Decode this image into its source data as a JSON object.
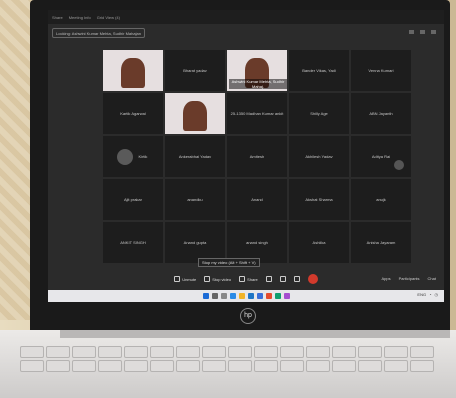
{
  "meeting_tabs": [
    "Share",
    "Meeting Info",
    "Grid View (4)"
  ],
  "locked_label": "Locking: Ashwini Kumar Mehta, Sudhir Mahajan",
  "participants": [
    {
      "name": "",
      "video": true
    },
    {
      "name": "Bharat yadav",
      "video": false
    },
    {
      "name": "Ashwini Kumar Mehta, Sudhir Mahaj.",
      "video": true
    },
    {
      "name": "Bander Vikas, Yadi",
      "video": false
    },
    {
      "name": "Venna Kumari",
      "video": false
    },
    {
      "name": "Kartik Agarwal",
      "video": false
    },
    {
      "name": "",
      "video": true
    },
    {
      "name": "25-1350 Madhan Kumar ankit",
      "video": false
    },
    {
      "name": "Shilly Age",
      "video": false
    },
    {
      "name": "ABN Jayanth",
      "video": false
    },
    {
      "name": "Kirtik",
      "video": false,
      "avatar": true
    },
    {
      "name": "Ankerabhai Yadav",
      "video": false
    },
    {
      "name": "Amitesh",
      "video": false
    },
    {
      "name": "Akhilesh Yadav",
      "video": false
    },
    {
      "name": "Aditya Rai",
      "video": false
    },
    {
      "name": "Ajit prakar",
      "video": false
    },
    {
      "name": "anandku",
      "video": false
    },
    {
      "name": "Anand",
      "video": false
    },
    {
      "name": "Akshat Sharma",
      "video": false
    },
    {
      "name": "anujk",
      "video": false
    },
    {
      "name": "ANKIT SINGH",
      "video": false
    },
    {
      "name": "Anand gupta",
      "video": false
    },
    {
      "name": "anand singh",
      "video": false
    },
    {
      "name": "Ashiika",
      "video": false
    },
    {
      "name": "Anisha Jayaram",
      "video": false
    }
  ],
  "tooltip": "Stop my video (Alt + Shift + V)",
  "controls": {
    "unmute": "Unmute",
    "stop_video": "Stop video",
    "share": "Share"
  },
  "apps": {
    "apps": "Apps",
    "participants": "Participants",
    "chat": "Chat"
  },
  "tray_text": "ENG",
  "brand": "hp",
  "colors": {
    "end_button": "#d23a2c",
    "taskbar": "#e7e7ea"
  }
}
